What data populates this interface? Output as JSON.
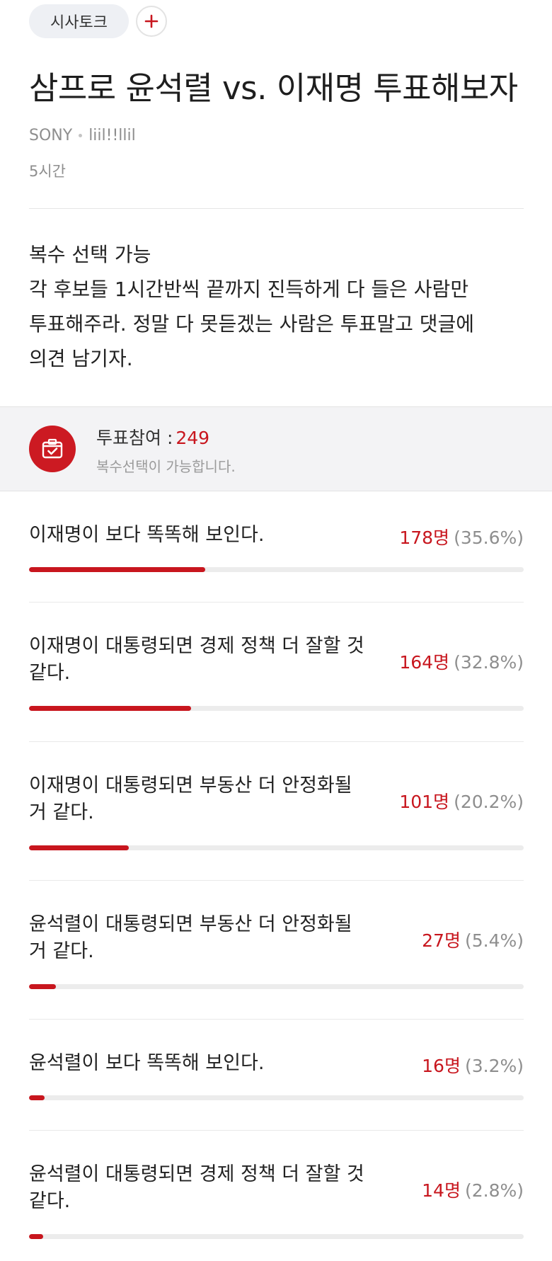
{
  "header": {
    "category": "시사토크",
    "add_icon": "plus-icon"
  },
  "post": {
    "title": "삼프로 윤석렬 vs. 이재명 투표해보자",
    "author_brand": "SONY",
    "author_name": "liil!!llil",
    "time_ago": "5시간",
    "body_lines": [
      "복수 선택 가능",
      "각 후보들 1시간반씩 끝까지 진득하게 다 들은 사람만",
      "투표해주라. 정말 다 못듣겠는 사람은 투표말고 댓글에",
      "의견 남기자."
    ]
  },
  "poll": {
    "icon": "ballot-box-icon",
    "participation_label": "투표참여 :",
    "participation_count": "249",
    "note": "복수선택이 가능합니다.",
    "accent_color": "#c8161e",
    "options": [
      {
        "label": "이재명이 보다 똑똑해 보인다.",
        "count": "178명",
        "percent": "(35.6%)",
        "ratio": 0.356
      },
      {
        "label": "이재명이 대통령되면 경제 정책 더 잘할 것 같다.",
        "count": "164명",
        "percent": "(32.8%)",
        "ratio": 0.328
      },
      {
        "label": "이재명이 대통령되면 부동산 더 안정화될 거 같다.",
        "count": "101명",
        "percent": "(20.2%)",
        "ratio": 0.202
      },
      {
        "label": "윤석렬이 대통령되면 부동산 더 안정화될 거 같다.",
        "count": "27명",
        "percent": "(5.4%)",
        "ratio": 0.054
      },
      {
        "label": "윤석렬이 보다 똑똑해 보인다.",
        "count": "16명",
        "percent": "(3.2%)",
        "ratio": 0.032
      },
      {
        "label": "윤석렬이 대통령되면 경제 정책 더 잘할 것 같다.",
        "count": "14명",
        "percent": "(2.8%)",
        "ratio": 0.028
      }
    ]
  }
}
